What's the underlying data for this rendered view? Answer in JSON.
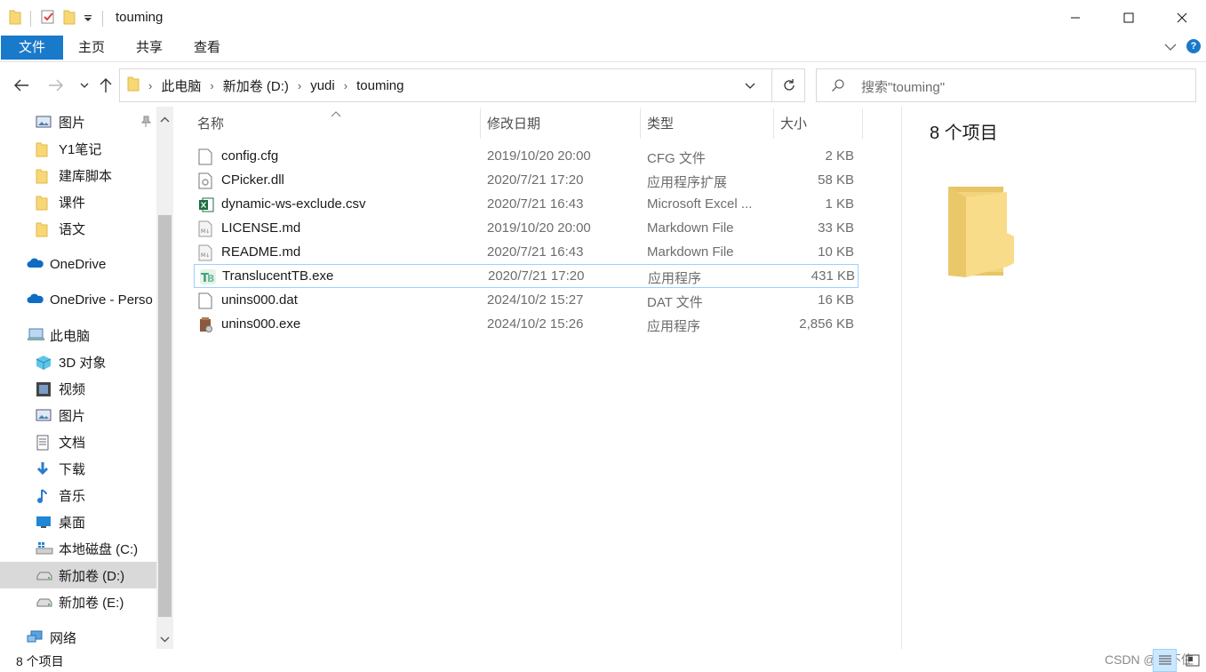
{
  "window": {
    "title": "touming"
  },
  "ribbon": {
    "tabs": [
      {
        "label": "文件"
      },
      {
        "label": "主页"
      },
      {
        "label": "共享"
      },
      {
        "label": "查看"
      }
    ]
  },
  "address": {
    "crumbs": [
      "此电脑",
      "新加卷 (D:)",
      "yudi",
      "touming"
    ]
  },
  "search": {
    "placeholder": "搜索\"touming\""
  },
  "sidebar": {
    "items": [
      {
        "label": "图片",
        "icon": "pictures-icon"
      },
      {
        "label": "Y1笔记",
        "icon": "folder-icon"
      },
      {
        "label": "建库脚本",
        "icon": "folder-icon"
      },
      {
        "label": "课件",
        "icon": "folder-icon"
      },
      {
        "label": "语文",
        "icon": "folder-icon"
      },
      {
        "label": "OneDrive",
        "icon": "onedrive-icon"
      },
      {
        "label": "OneDrive - Perso",
        "icon": "onedrive-icon"
      },
      {
        "label": "此电脑",
        "icon": "this-pc-icon"
      },
      {
        "label": "3D 对象",
        "icon": "3d-objects-icon"
      },
      {
        "label": "视频",
        "icon": "videos-icon"
      },
      {
        "label": "图片",
        "icon": "pictures-icon"
      },
      {
        "label": "文档",
        "icon": "documents-icon"
      },
      {
        "label": "下载",
        "icon": "downloads-icon"
      },
      {
        "label": "音乐",
        "icon": "music-icon"
      },
      {
        "label": "桌面",
        "icon": "desktop-icon"
      },
      {
        "label": "本地磁盘 (C:)",
        "icon": "windows-drive-icon"
      },
      {
        "label": "新加卷 (D:)",
        "icon": "drive-icon"
      },
      {
        "label": "新加卷 (E:)",
        "icon": "drive-icon"
      },
      {
        "label": "网络",
        "icon": "network-icon"
      }
    ]
  },
  "columns": {
    "name": "名称",
    "date": "修改日期",
    "type": "类型",
    "size": "大小"
  },
  "files": [
    {
      "name": "config.cfg",
      "date": "2019/10/20 20:00",
      "type": "CFG 文件",
      "size": "2 KB",
      "icon": "file-icon"
    },
    {
      "name": "CPicker.dll",
      "date": "2020/7/21 17:20",
      "type": "应用程序扩展",
      "size": "58 KB",
      "icon": "dll-icon"
    },
    {
      "name": "dynamic-ws-exclude.csv",
      "date": "2020/7/21 16:43",
      "type": "Microsoft Excel ...",
      "size": "1 KB",
      "icon": "excel-icon"
    },
    {
      "name": "LICENSE.md",
      "date": "2019/10/20 20:00",
      "type": "Markdown File",
      "size": "33 KB",
      "icon": "markdown-icon"
    },
    {
      "name": "README.md",
      "date": "2020/7/21 16:43",
      "type": "Markdown File",
      "size": "10 KB",
      "icon": "markdown-icon"
    },
    {
      "name": "TranslucentTB.exe",
      "date": "2020/7/21 17:20",
      "type": "应用程序",
      "size": "431 KB",
      "icon": "translucenttb-icon"
    },
    {
      "name": "unins000.dat",
      "date": "2024/10/2 15:27",
      "type": "DAT 文件",
      "size": "16 KB",
      "icon": "file-icon"
    },
    {
      "name": "unins000.exe",
      "date": "2024/10/2 15:26",
      "type": "应用程序",
      "size": "2,856 KB",
      "icon": "installer-icon"
    }
  ],
  "preview": {
    "count": "8 个项目"
  },
  "status": {
    "text": "8 个项目",
    "watermark": "CSDN @冬不住"
  }
}
